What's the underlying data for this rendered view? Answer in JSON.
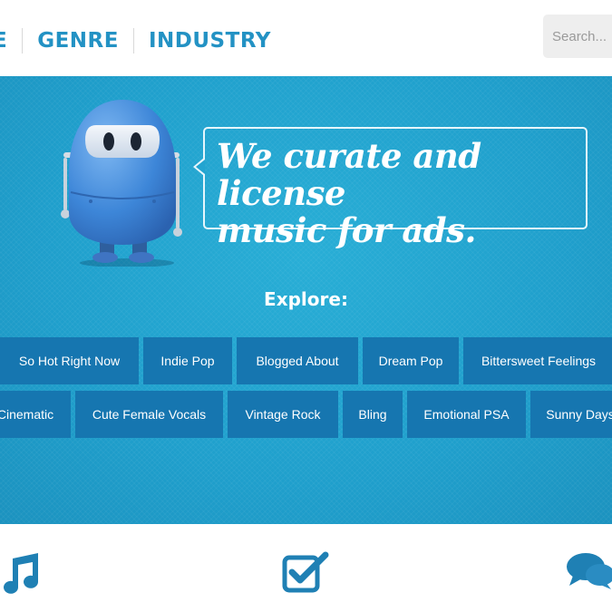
{
  "nav": {
    "partial_item": "E",
    "items": [
      "GENRE",
      "INDUSTRY"
    ]
  },
  "search": {
    "placeholder": "Search..."
  },
  "hero": {
    "tagline_line1": "We curate and license",
    "tagline_line2": "music for ads.",
    "explore_label": "Explore:",
    "tags_row1": [
      "So Hot Right Now",
      "Indie Pop",
      "Blogged About",
      "Dream Pop",
      "Bittersweet Feelings"
    ],
    "tags_row2": [
      "Cinematic",
      "Cute Female Vocals",
      "Vintage Rock",
      "Bling",
      "Emotional PSA",
      "Sunny Days"
    ]
  },
  "features": {
    "icons": [
      "music-note-icon",
      "checkbox-icon",
      "speech-bubbles-icon"
    ]
  },
  "colors": {
    "brand_blue": "#2392c4",
    "hero_bg": "#1f9fcc",
    "tag_bg": "#1676b0",
    "icon_blue": "#1f80b4"
  }
}
